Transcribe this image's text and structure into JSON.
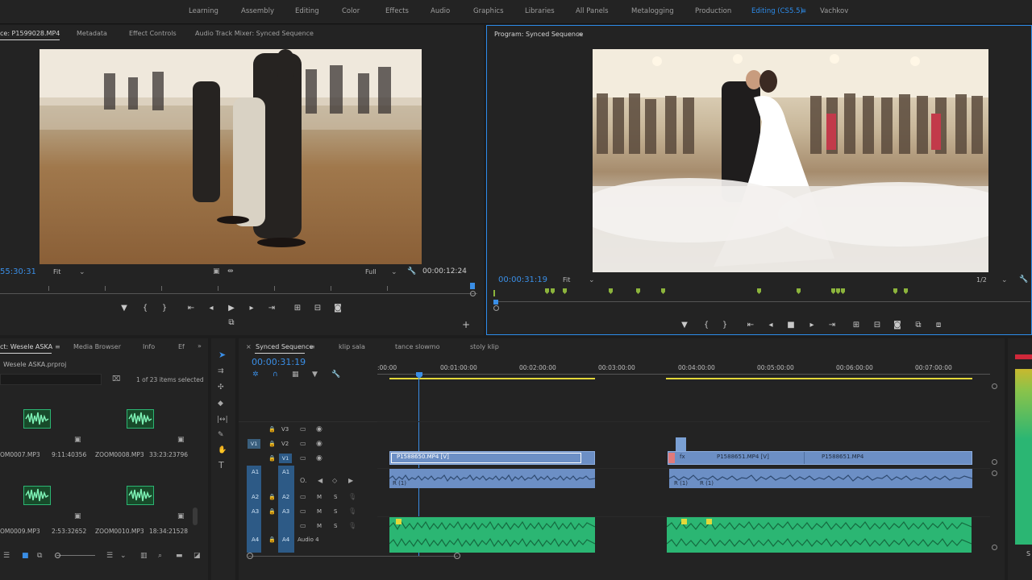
{
  "workspaces": {
    "items": [
      "Learning",
      "Assembly",
      "Editing",
      "Color",
      "Effects",
      "Audio",
      "Graphics",
      "Libraries",
      "All Panels",
      "Metalogging",
      "Production",
      "Editing (CS5.5)",
      "Vachkov"
    ],
    "active_index": 11,
    "menu_glyph": "≡"
  },
  "source": {
    "tabs": [
      "ce: P1599028.MP4",
      "Metadata",
      "Effect Controls",
      "Audio Track Mixer: Synced Sequence"
    ],
    "menu_glyph": "≡",
    "timecode": "55:30:31",
    "fit": "Fit",
    "quality": "Full",
    "duration": "00:00:12:24"
  },
  "program": {
    "title": "Program: Synced Sequence",
    "menu_glyph": "≡",
    "timecode": "00:00:31:19",
    "fit": "Fit",
    "resolution": "1/2"
  },
  "project": {
    "tabs": [
      "ct: Wesele ASKA",
      "Media Browser",
      "Info",
      "Ef"
    ],
    "file": "Wesele ASKA.prproj",
    "selection": "1 of 23 items selected",
    "items": [
      {
        "name": "OM0007.MP3",
        "duration": "9:11:40356"
      },
      {
        "name": "ZOOM0008.MP3",
        "duration": "33:23:23796"
      },
      {
        "name": "OM0009.MP3",
        "duration": "2:53:32652"
      },
      {
        "name": "ZOOM0010.MP3",
        "duration": "18:34:21528"
      }
    ]
  },
  "timeline": {
    "tabs": [
      "Synced Sequence",
      "klip sala",
      "tance slowmo",
      "stoly klip"
    ],
    "menu_glyph": "≡",
    "timecode": "00:00:31:19",
    "ruler": [
      ":00:00",
      "00:01:00:00",
      "00:02:00:00",
      "00:03:00:00",
      "00:04:00:00",
      "00:05:00:00",
      "00:06:00:00",
      "00:07:00:00"
    ],
    "video_tracks": [
      "V3",
      "V2",
      "V1"
    ],
    "audio_tracks": [
      "A1",
      "A2",
      "A3",
      "A4"
    ],
    "source_v": "V1",
    "source_a": "A1",
    "audio4_label": "Audio 4",
    "clips": {
      "v1_a": "P1588650.MP4 [V]",
      "v1_b": "P1588651.MP4 [V]",
      "v1_c": "P1588651.MP4",
      "fx1": "R (1)",
      "fx2": "R (1)",
      "fx3": "R (1)",
      "fx_v": "fx"
    },
    "audio_buttons": {
      "m": "M",
      "s": "S"
    }
  },
  "meter": {
    "right_label": "S"
  }
}
